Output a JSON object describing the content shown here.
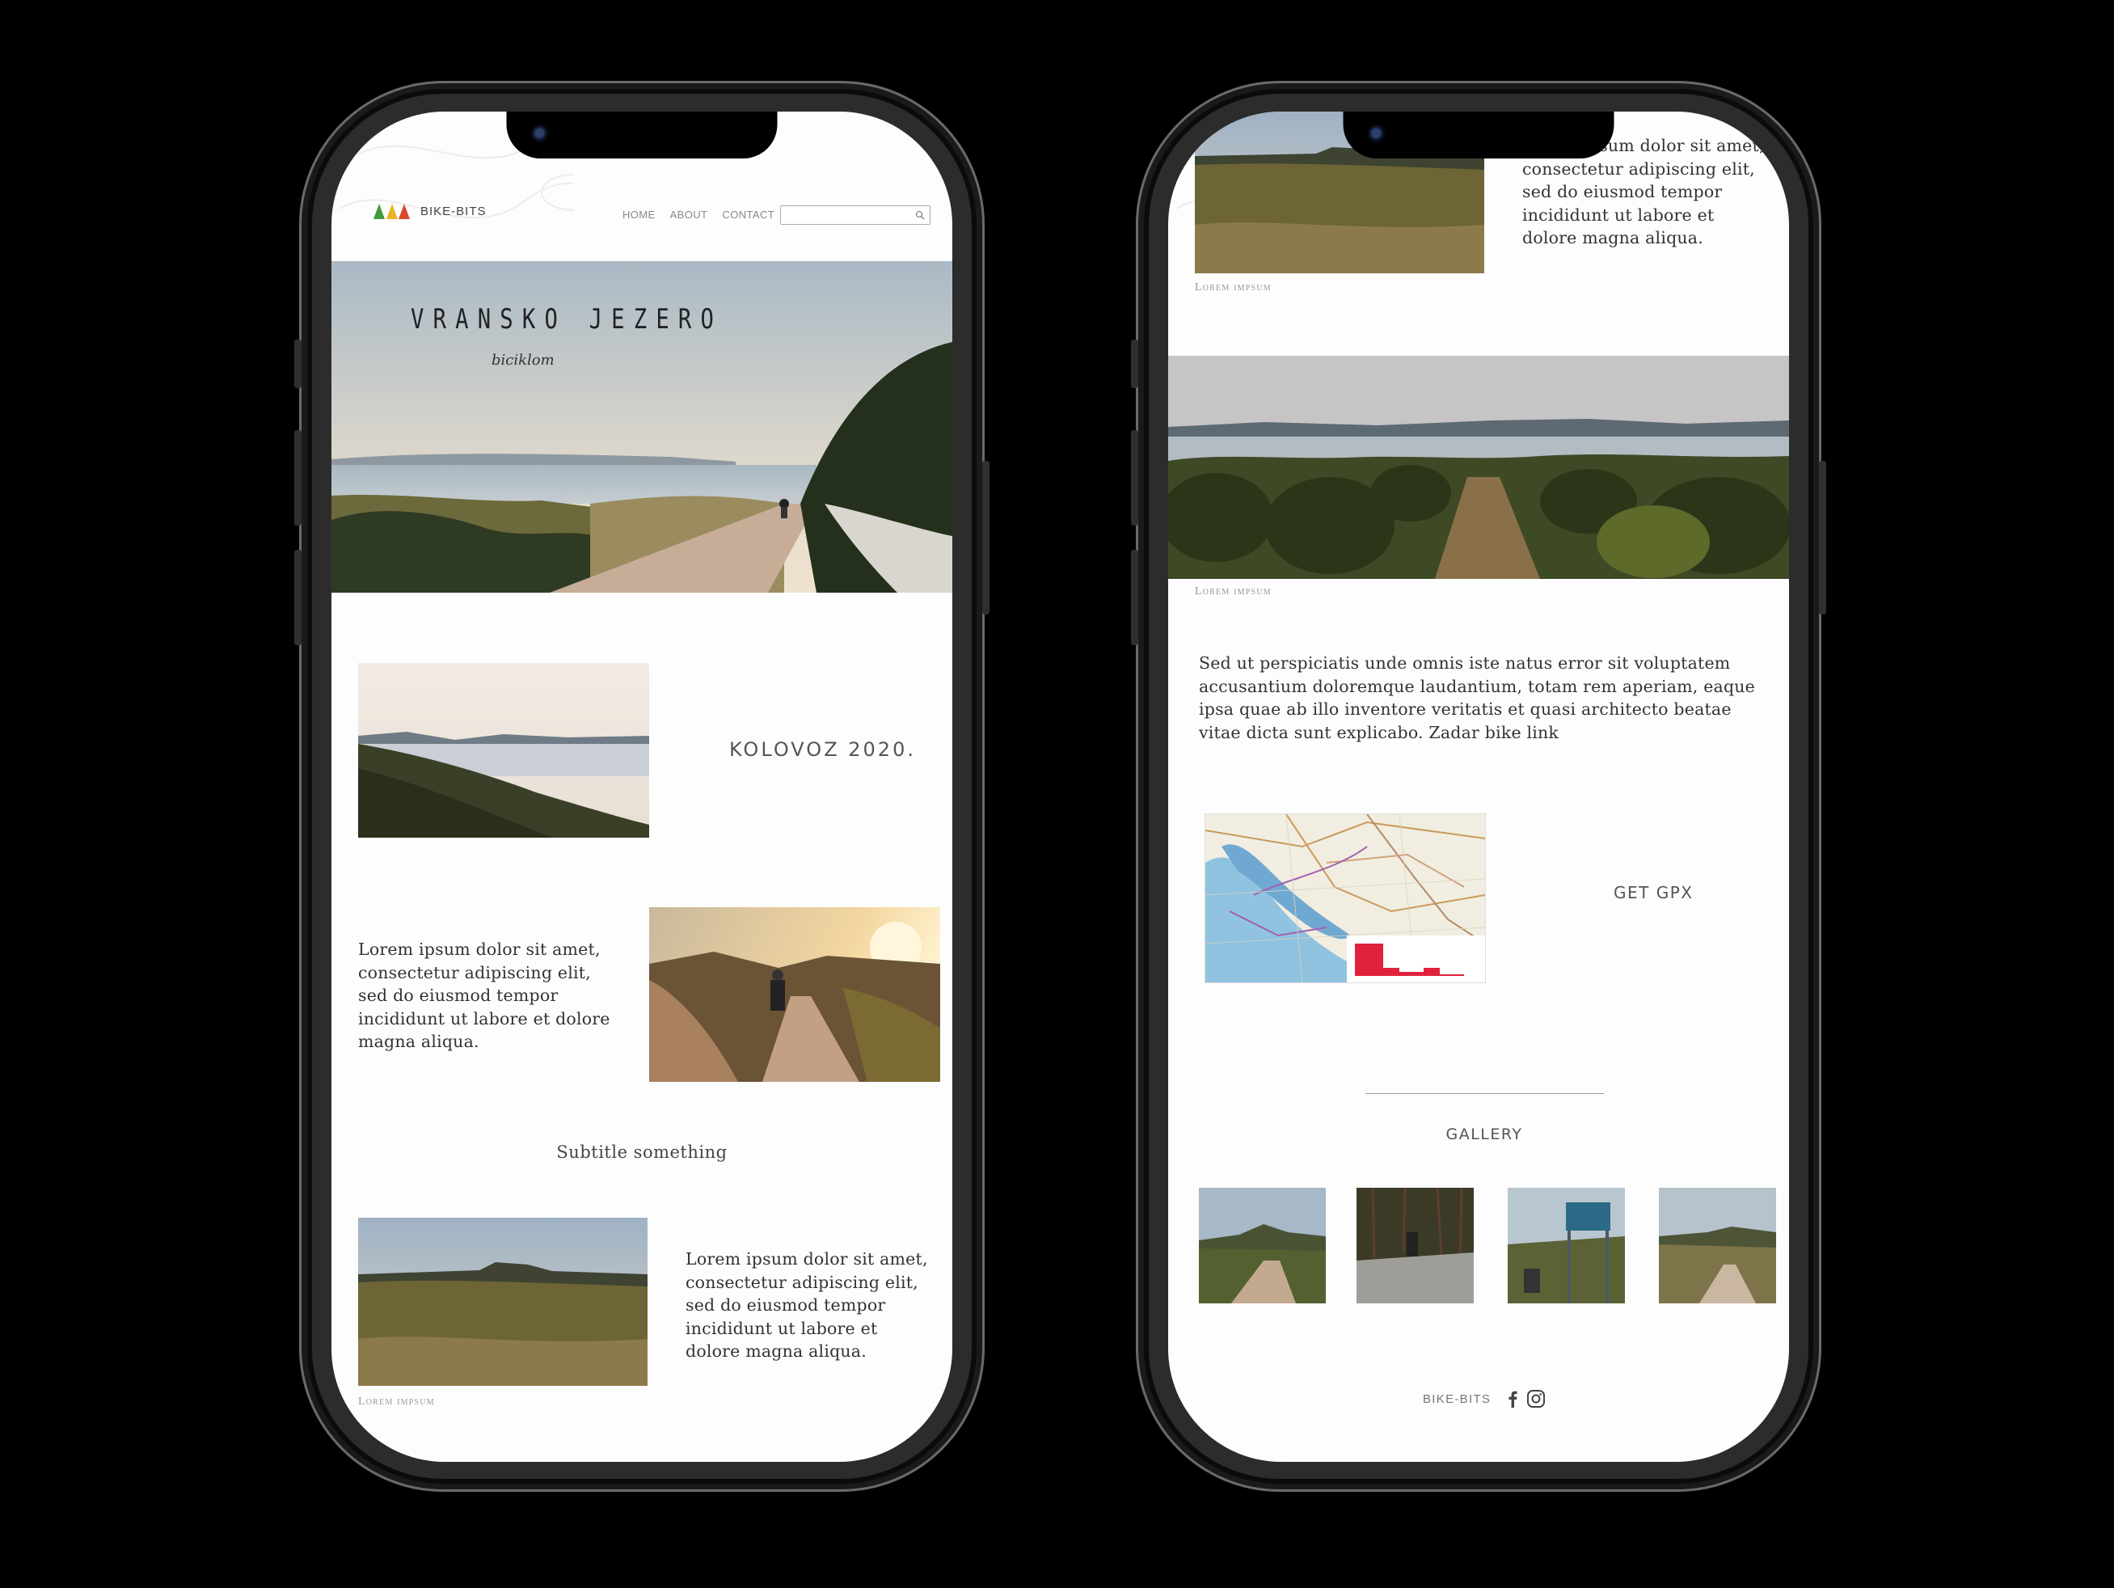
{
  "left_screen": {
    "header": {
      "logo_text": "BIKE-BITS",
      "nav": [
        "HOME",
        "ABOUT",
        "CONTACT"
      ],
      "search_placeholder": ""
    },
    "hero": {
      "title": "VRANSKO JEZERO",
      "signature": "biciklom"
    },
    "date_label": "KOLOVOZ 2020.",
    "paragraph_1": "Lorem ipsum dolor sit amet, consectetur adipiscing elit, sed do eiusmod tempor incididunt ut labore et dolore magna aliqua.",
    "subtitle": "Subtitle something",
    "paragraph_2": "Lorem ipsum dolor sit amet, consectetur adipiscing elit, sed do eiusmod tempor incididunt ut labore et dolore magna aliqua.",
    "caption": "Lorem impsum"
  },
  "right_screen": {
    "top_paragraph": "Lorem ipsum dolor sit amet, consectetur adipiscing elit, sed do eiusmod tempor incididunt ut labore et dolore magna aliqua.",
    "top_caption": "Lorem impsum",
    "panorama_caption": "Lorem impsum",
    "long_paragraph": "Sed ut perspiciatis unde omnis iste natus error sit voluptatem accusantium doloremque laudantium, totam rem aperiam, eaque ipsa quae ab illo inventore veritatis et quasi architecto beatae vitae dicta sunt explicabo. Zadar bike link",
    "gpx_button": "GET GPX",
    "gallery_title": "GALLERY",
    "footer_brand": "BIKE-BITS"
  },
  "icons": {
    "logo": "three-triangles-logo-icon",
    "search": "search-icon",
    "facebook": "facebook-icon",
    "instagram": "instagram-icon"
  },
  "colors": {
    "logo_green": "#3f9a3a",
    "logo_yellow": "#e8b422",
    "logo_red": "#d94b2b",
    "elevation_red": "#e0223c"
  }
}
